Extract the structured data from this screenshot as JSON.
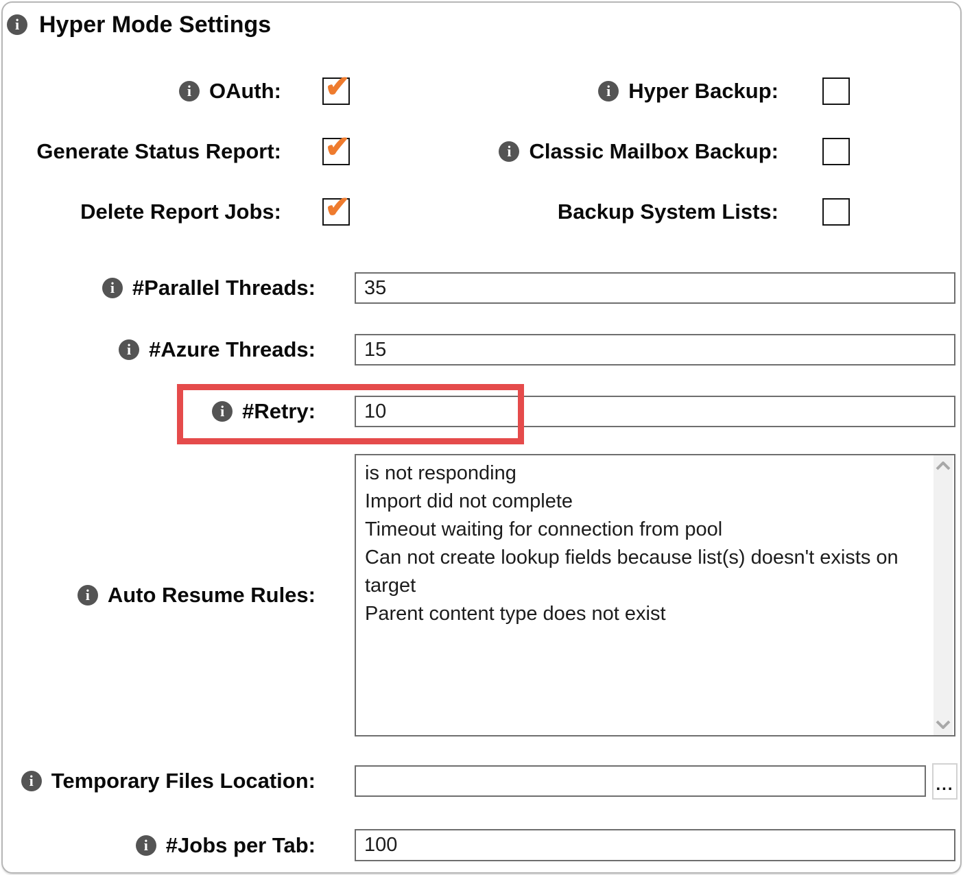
{
  "title": "Hyper Mode Settings",
  "icons": {
    "info": "i",
    "check": "✔",
    "scroll_up": "chevron-up-icon",
    "scroll_down": "chevron-down-icon"
  },
  "colors": {
    "check_orange": "#ee7b2e",
    "highlight_red": "#e54b4b",
    "info_gray": "#545454",
    "input_border": "#6e6e6e"
  },
  "checkboxes": {
    "oauth": {
      "label": "OAuth:",
      "checked": true,
      "mark": "✔"
    },
    "hyper_backup": {
      "label": "Hyper Backup:",
      "checked": false,
      "mark": ""
    },
    "generate_status_report": {
      "label": "Generate Status Report:",
      "checked": true,
      "mark": "✔"
    },
    "classic_mailbox_backup": {
      "label": "Classic Mailbox Backup:",
      "checked": false,
      "mark": ""
    },
    "delete_report_jobs": {
      "label": "Delete Report Jobs:",
      "checked": true,
      "mark": "✔"
    },
    "backup_system_lists": {
      "label": "Backup System Lists:",
      "checked": false,
      "mark": ""
    }
  },
  "fields": {
    "parallel_threads": {
      "label": "#Parallel Threads:",
      "value": "35"
    },
    "azure_threads": {
      "label": "#Azure Threads:",
      "value": "15"
    },
    "retry": {
      "label": "#Retry:",
      "value": "10",
      "highlighted": true
    },
    "auto_resume_rules": {
      "label": "Auto Resume Rules:",
      "value": "is not responding\nImport did not complete\nTimeout waiting for connection from pool\nCan not create lookup fields because list(s) doesn't exists on target\nParent content type does not exist"
    },
    "temporary_files_location": {
      "label": "Temporary Files Location:",
      "value": "",
      "browse_label": "..."
    },
    "jobs_per_tab": {
      "label": "#Jobs per Tab:",
      "value": "100"
    }
  }
}
